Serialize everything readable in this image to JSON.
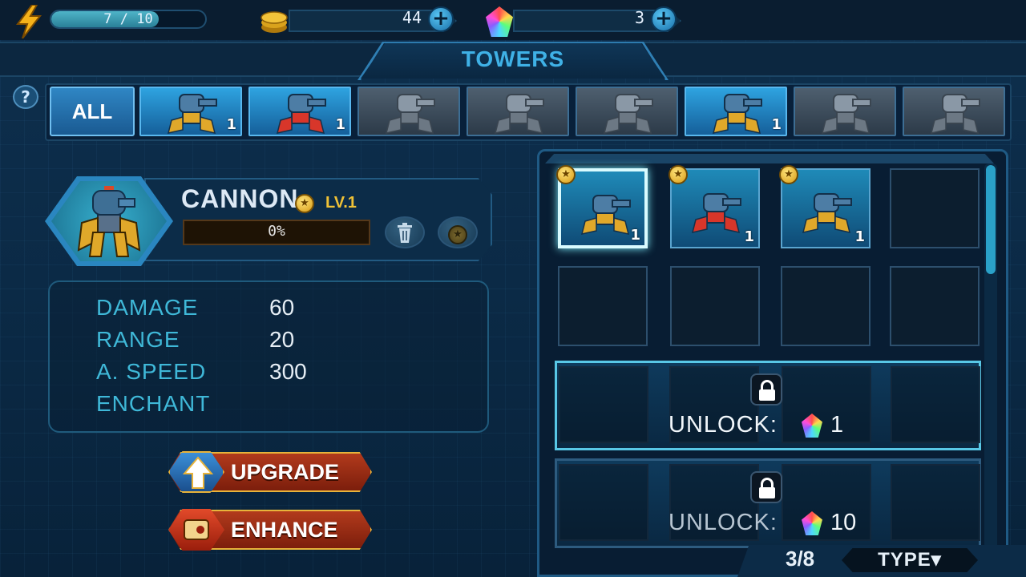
{
  "top_bar": {
    "energy": {
      "text": "7 / 10",
      "fraction": 0.7
    },
    "coins": {
      "value": "44"
    },
    "gems": {
      "value": "3"
    },
    "plus_label": "+"
  },
  "header": {
    "title": "TOWERS"
  },
  "help_label": "?",
  "filters": {
    "all_label": "ALL",
    "tiles": [
      {
        "icon": "cannon-tower-icon",
        "count": "1",
        "state": "owned"
      },
      {
        "icon": "missile-tower-icon",
        "count": "1",
        "state": "owned"
      },
      {
        "icon": "heavy-launcher-tower-icon",
        "count": "",
        "state": "locked"
      },
      {
        "icon": "twin-gun-tower-icon",
        "count": "",
        "state": "locked"
      },
      {
        "icon": "mortar-tower-icon",
        "count": "",
        "state": "locked"
      },
      {
        "icon": "blaster-tower-icon",
        "count": "1",
        "state": "owned"
      },
      {
        "icon": "railgun-tower-icon",
        "count": "",
        "state": "locked"
      },
      {
        "icon": "drill-tower-icon",
        "count": "",
        "state": "locked"
      }
    ]
  },
  "tower": {
    "name": "CANNON",
    "level": "LV.1",
    "xp": {
      "text": "0%",
      "fraction": 0
    },
    "star_icon": "star-coin-icon"
  },
  "stats": [
    {
      "label": "DAMAGE",
      "value": "60"
    },
    {
      "label": "RANGE",
      "value": "20"
    },
    {
      "label": "A. SPEED",
      "value": "300"
    },
    {
      "label": "ENCHANT",
      "value": ""
    }
  ],
  "actions": {
    "upgrade_label": "UPGRADE",
    "enhance_label": "ENHANCE"
  },
  "inventory": {
    "owned": [
      {
        "icon": "cannon-tower-icon",
        "count": "1",
        "selected": true
      },
      {
        "icon": "missile-tower-icon",
        "count": "1",
        "selected": false
      },
      {
        "icon": "blaster-tower-icon",
        "count": "1",
        "selected": false
      }
    ],
    "unlock_rows": [
      {
        "label": "UNLOCK:",
        "cost": "1"
      },
      {
        "label": "UNLOCK:",
        "cost": "10"
      }
    ],
    "page": "3/8",
    "type_label": "TYPE▾"
  },
  "colors": {
    "accent": "#3fb1e6",
    "stat_label": "#3fb8d8",
    "level_gold": "#f0c236",
    "button_red": "#b23a1c",
    "selected_glow": "#7ef0ff"
  }
}
